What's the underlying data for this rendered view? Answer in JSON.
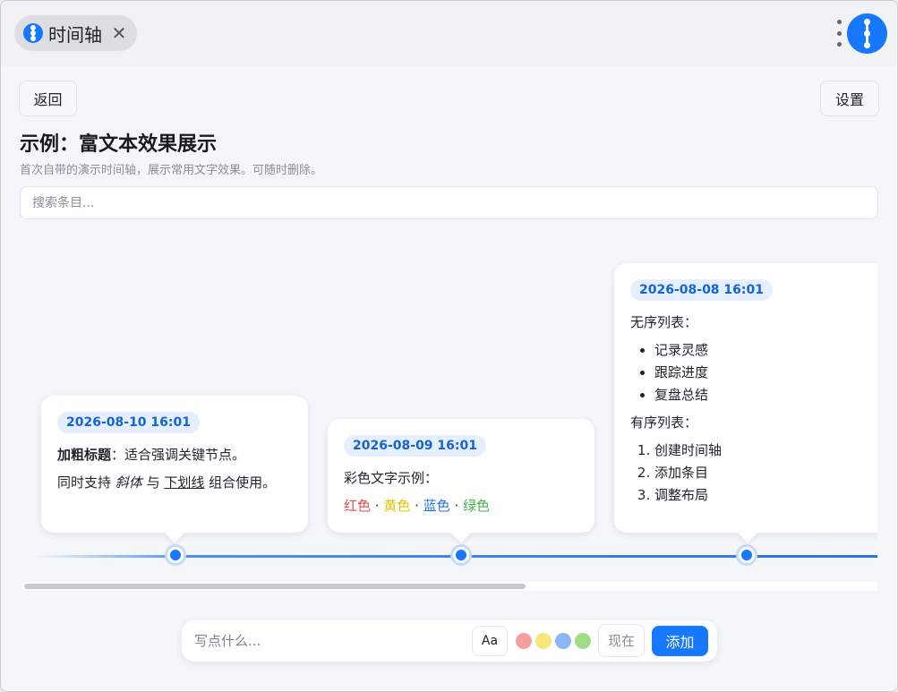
{
  "window": {
    "tab_title": "时间轴",
    "close_glyph": "✕"
  },
  "header": {
    "back_label": "返回",
    "settings_label": "设置",
    "title": "示例：富文本效果展示",
    "subtitle": "首次自带的演示时间轴，展示常用文字效果。可随时删除。"
  },
  "search": {
    "placeholder": "搜索条目..."
  },
  "timeline": {
    "entries": [
      {
        "date": "2026-08-10 16:01",
        "bold_title": "加粗标题",
        "title_rest": "：适合强调关键节点。",
        "line2_a": "同时支持 ",
        "italic": "斜体",
        "line2_b": " 与 ",
        "underline": "下划线",
        "line2_c": " 组合使用。"
      },
      {
        "date": "2026-08-09 16:01",
        "intro": "彩色文字示例：",
        "colors": [
          "红色",
          "黄色",
          "蓝色",
          "绿色"
        ],
        "separator": " · "
      },
      {
        "date": "2026-08-08 16:01",
        "unordered_heading": "无序列表：",
        "unordered": [
          "记录灵感",
          "跟踪进度",
          "复盘总结"
        ],
        "ordered_heading": "有序列表：",
        "ordered": [
          "创建时间轴",
          "添加条目",
          "调整布局"
        ]
      }
    ]
  },
  "composer": {
    "placeholder": "写点什么...",
    "format_label": "Aa",
    "now_label": "现在",
    "add_label": "添加",
    "swatches": [
      "#f4a0a0",
      "#f7e67a",
      "#8ab6f5",
      "#9ddd86"
    ]
  },
  "colors": {
    "accent": "#1677ff",
    "red_text": "#e5484d",
    "yellow_text": "#e5c300",
    "blue_text": "#1f74e8",
    "green_text": "#46b04a"
  }
}
